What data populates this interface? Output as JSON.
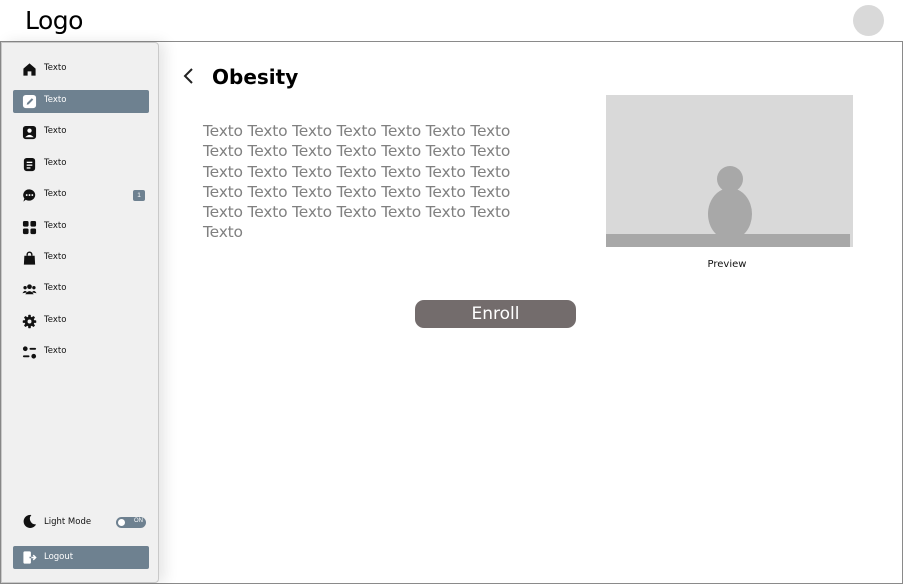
{
  "header": {
    "logo": "Logo"
  },
  "sidebar": {
    "items": [
      {
        "label": "Texto",
        "icon": "home-icon"
      },
      {
        "label": "Texto",
        "icon": "edit-icon",
        "active": true
      },
      {
        "label": "Texto",
        "icon": "image-icon"
      },
      {
        "label": "Texto",
        "icon": "document-icon"
      },
      {
        "label": "Texto",
        "icon": "chat-icon",
        "badge": "1"
      },
      {
        "label": "Texto",
        "icon": "grid-icon"
      },
      {
        "label": "Texto",
        "icon": "bag-icon"
      },
      {
        "label": "Texto",
        "icon": "users-icon"
      },
      {
        "label": "Texto",
        "icon": "gear-icon"
      },
      {
        "label": "Texto",
        "icon": "sliders-icon"
      }
    ],
    "light_mode": {
      "label": "Light Mode",
      "toggle": "ON",
      "icon": "moon-icon"
    },
    "logout": {
      "label": "Logout",
      "icon": "logout-icon"
    }
  },
  "main": {
    "title": "Obesity",
    "description": "Texto Texto Texto Texto Texto Texto Texto Texto Texto Texto Texto Texto Texto Texto Texto Texto Texto Texto Texto Texto Texto Texto Texto Texto Texto Texto Texto Texto Texto Texto Texto Texto Texto Texto Texto Texto",
    "preview_label": "Preview",
    "enroll_label": "Enroll"
  },
  "colors": {
    "accent": "#6e8190",
    "button": "#736c6c",
    "placeholder": "#d9d9d9",
    "body_text": "#808080"
  }
}
